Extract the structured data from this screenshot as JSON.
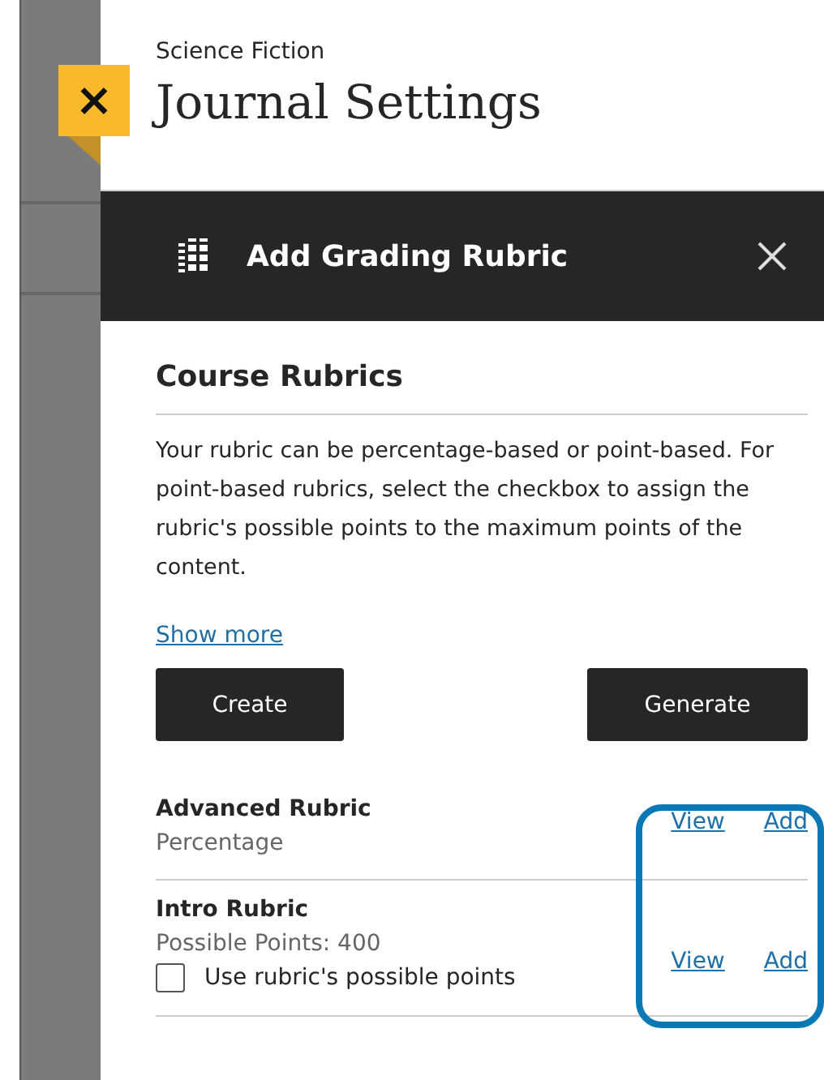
{
  "header": {
    "course": "Science Fiction",
    "title": "Journal Settings",
    "close_icon": "×"
  },
  "panel": {
    "title": "Add Grading Rubric"
  },
  "section": {
    "title": "Course Rubrics",
    "description": "Your rubric can be percentage-based or point-based. For point-based rubrics, select the checkbox to assign the rubric's possible points to the maximum points of the content.",
    "show_more": "Show more"
  },
  "buttons": [
    "Create",
    "Generate"
  ],
  "rubrics": [
    {
      "name": "Advanced Rubric",
      "detail": "Percentage",
      "view": "View",
      "add": "Add"
    },
    {
      "name": "Intro Rubric",
      "detail": "Possible Points: 400",
      "view": "View",
      "add": "Add",
      "option": {
        "label": "Use rubric's possible points",
        "checked": false
      }
    }
  ]
}
